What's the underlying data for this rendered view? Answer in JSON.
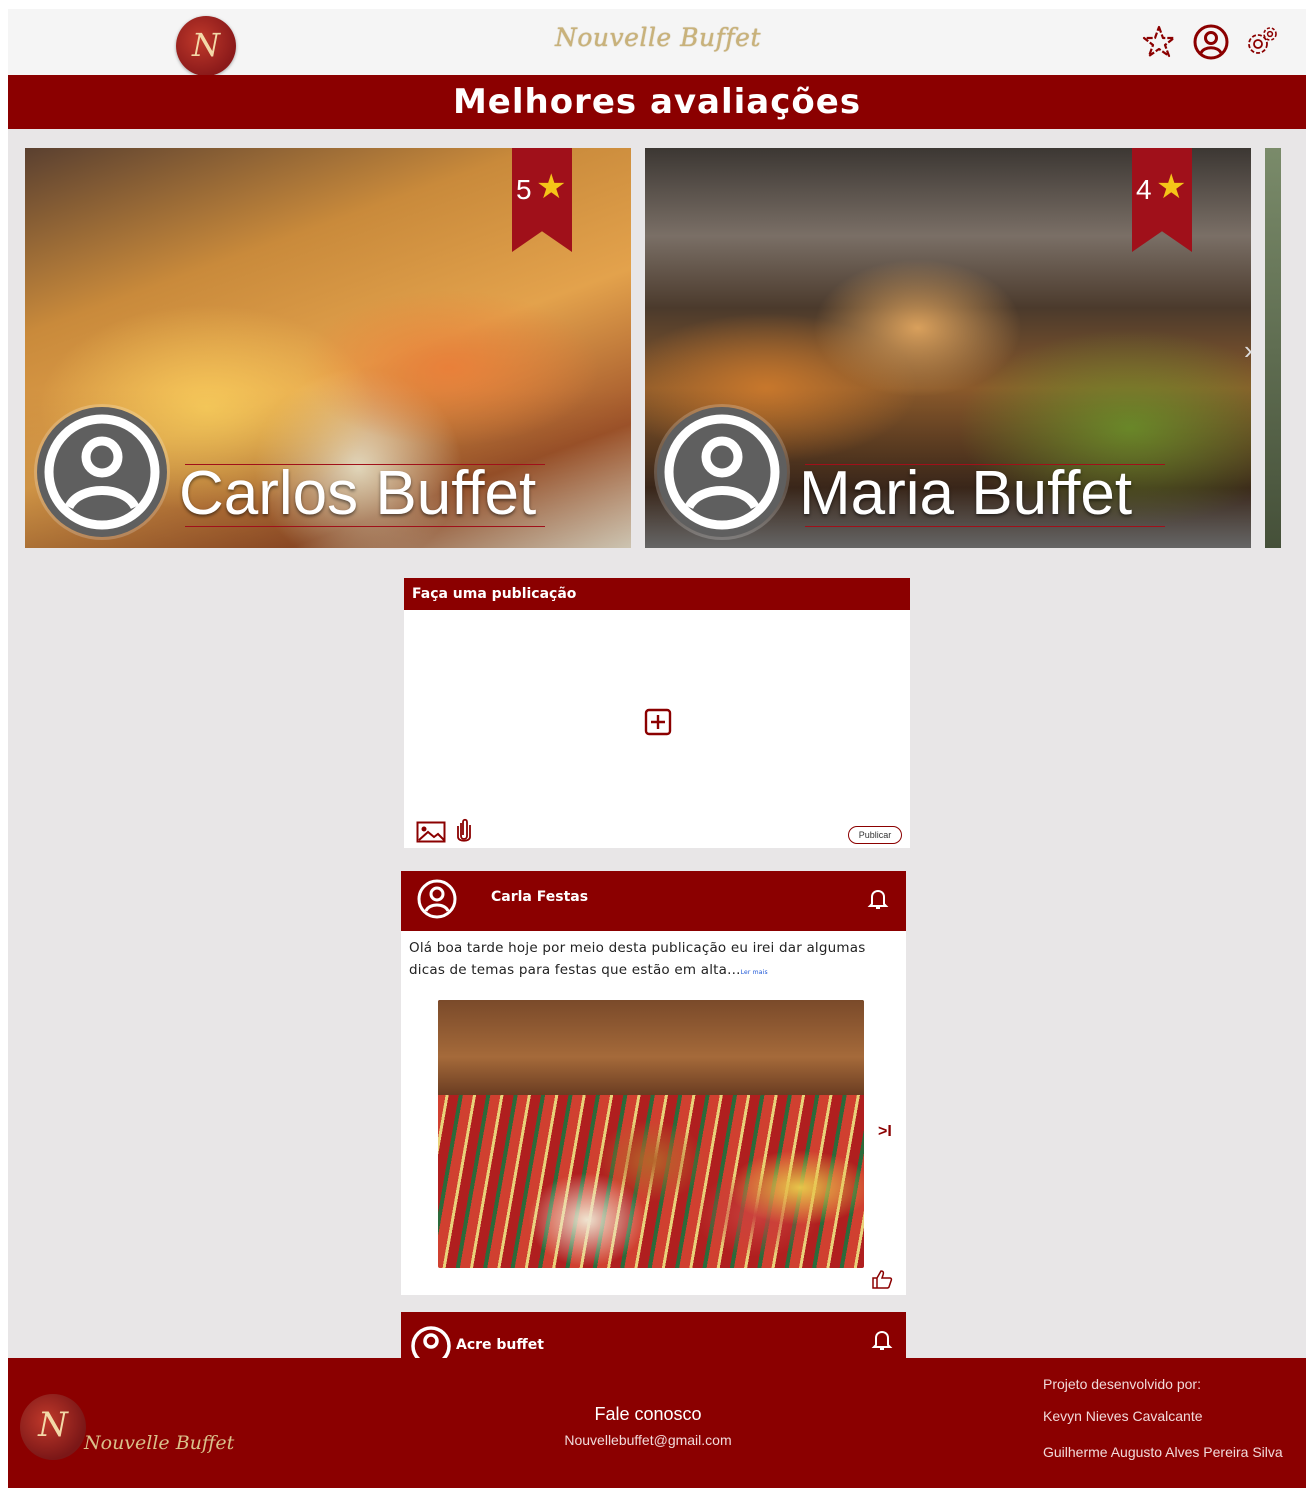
{
  "header": {
    "logo_letter": "N",
    "brand": "Nouvelle Buffet",
    "icons": [
      "star-icon",
      "user-icon",
      "gear-icon"
    ]
  },
  "banner": {
    "title": "Melhores avaliações"
  },
  "carousel": {
    "cards": [
      {
        "name": "Carlos Buffet",
        "rating": "5"
      },
      {
        "name": "Maria Buffet",
        "rating": "4"
      }
    ],
    "next_icon": "chevron-right-icon"
  },
  "composer": {
    "title": "Faça uma publicação",
    "publish_label": "Publicar"
  },
  "post": {
    "author": "Carla Festas",
    "text": "Olá boa tarde hoje por meio desta publicação eu irei dar algumas dicas de temas para festas que estão em alta...",
    "read_more": "Ler mais",
    "next_label": ">I"
  },
  "post2": {
    "author": "Acre buffet"
  },
  "footer": {
    "logo_letter": "N",
    "brand": "Nouvelle Buffet",
    "contact_title": "Fale conosco",
    "contact_email": "Nouvellebuffet@gmail.com",
    "credits_title": "Projeto desenvolvido por:",
    "credits_name1": "Kevyn Nieves Cavalcante",
    "credits_name2": "Guilherme Augusto Alves Pereira Silva"
  },
  "colors": {
    "primary": "#8b0000",
    "background": "#e8e6e7",
    "gold": "#c9b27a",
    "star": "#f5c518"
  }
}
